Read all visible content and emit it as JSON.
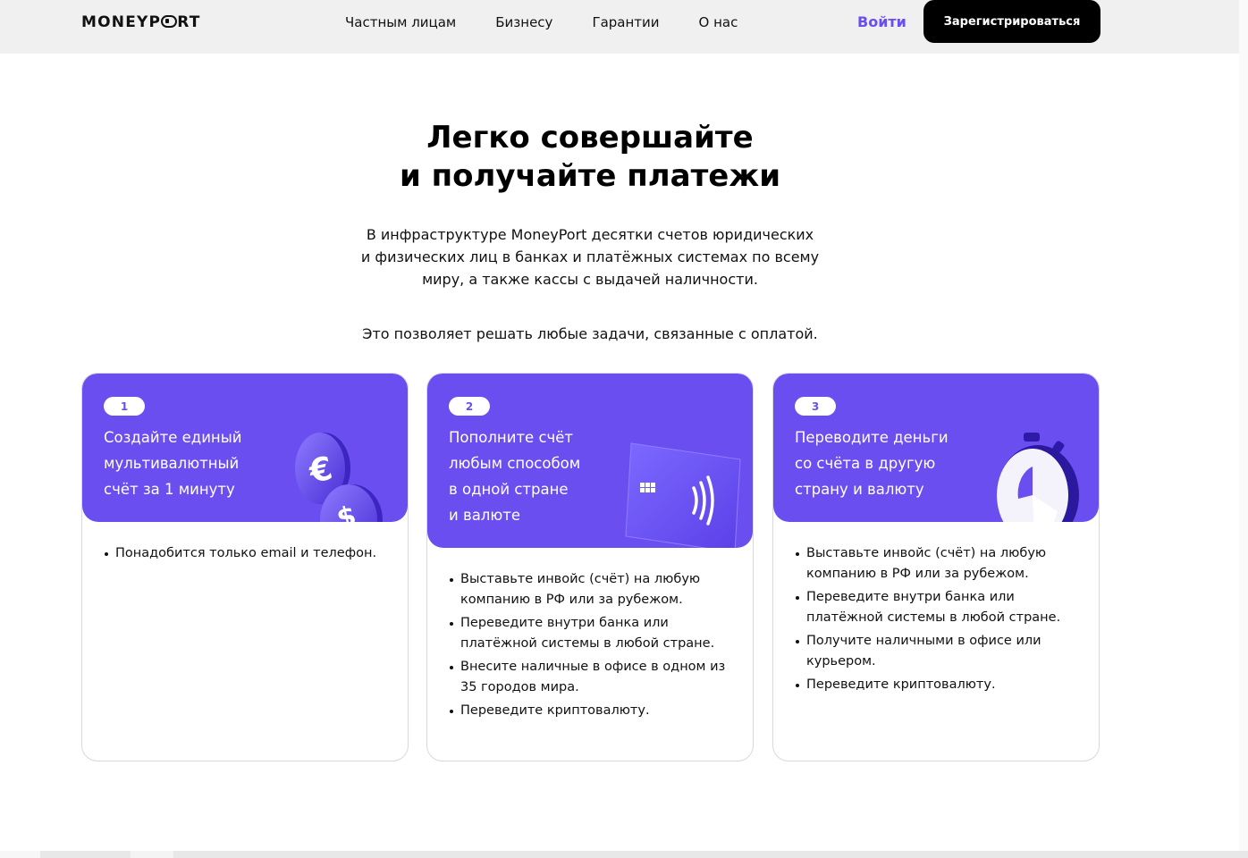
{
  "header": {
    "logo": "MONEYPORT",
    "nav": [
      "Частным лицам",
      "Бизнесу",
      "Гарантии",
      "О нас"
    ],
    "login": "Войти",
    "register": "Зарегистрироваться"
  },
  "hero": {
    "title_line1": "Легко совершайте",
    "title_line2": "и получайте платежи",
    "desc_line1": "В инфраструктуре MoneyPort десятки счетов юридических",
    "desc_line2": "и физических лиц в банках и платёжных системах по всему",
    "desc_line3": "миру, а также кассы с выдачей наличности.",
    "desc2": "Это позволяет решать любые задачи, связанные с оплатой."
  },
  "cards": [
    {
      "number": "1",
      "title_lines": [
        "Создайте единый",
        "мультивалютный",
        "счёт за 1 минуту"
      ],
      "items": [
        "Понадобится только email и телефон."
      ],
      "icon": "coins-icon"
    },
    {
      "number": "2",
      "title_lines": [
        "Пополните счёт",
        "любым способом",
        "в одной стране",
        "и валюте"
      ],
      "items": [
        "Выставьте инвойс (счёт) на любую компанию в РФ или за рубежом.",
        "Переведите внутри банка или платёжной системы в любой стране.",
        "Внесите наличные в офисе в одном из 35 городов мира.",
        "Переведите криптовалюту."
      ],
      "icon": "card-icon"
    },
    {
      "number": "3",
      "title_lines": [
        "Переводите деньги",
        "со счёта в другую",
        "страну и валюту"
      ],
      "items": [
        "Выставьте инвойс (счёт) на любую компанию в РФ или за рубежом.",
        "Переведите внутри банка или платёжной системы в любой стране.",
        "Получите наличными в офисе или курьером.",
        "Переведите криптовалюту."
      ],
      "icon": "stopwatch-icon"
    }
  ],
  "colors": {
    "accent": "#6b4ef0",
    "header_bg": "#f0f0f0",
    "button_bg": "#000000"
  }
}
